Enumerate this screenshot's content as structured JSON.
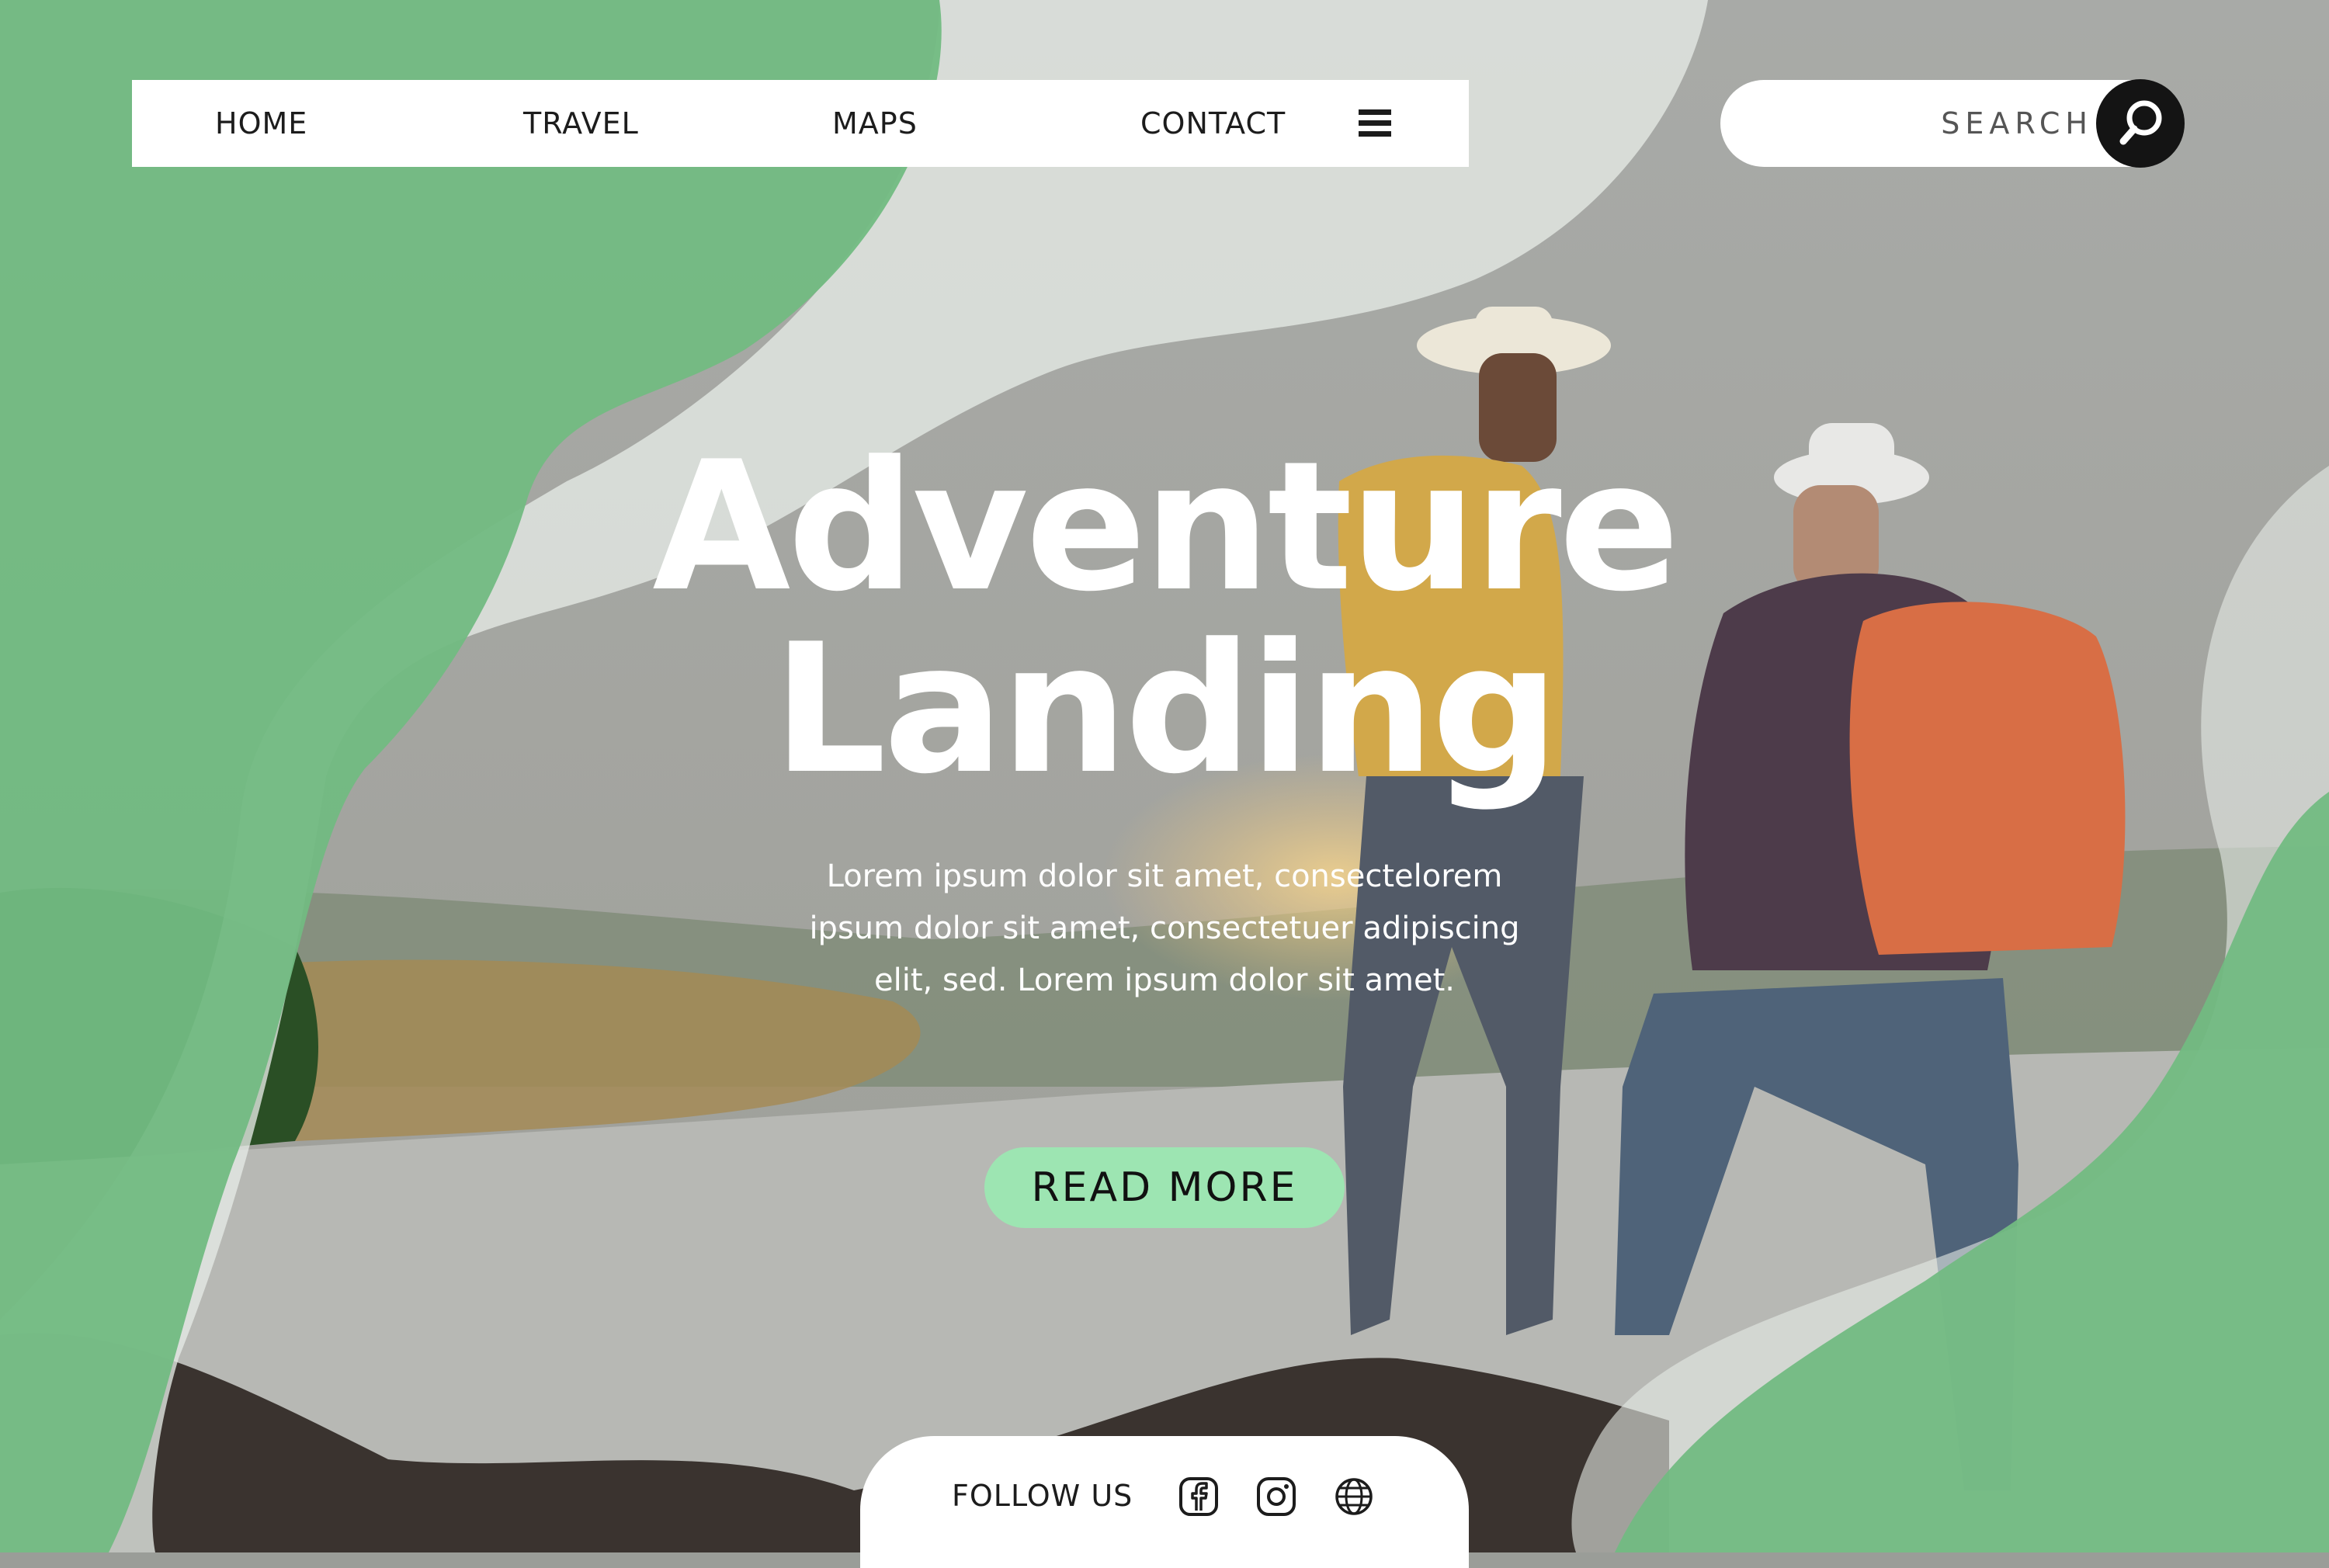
{
  "nav": {
    "items": [
      {
        "label": "HOME"
      },
      {
        "label": "TRAVEL"
      },
      {
        "label": "MAPS"
      },
      {
        "label": "CONTACT"
      }
    ],
    "menu_icon": "hamburger-menu-icon"
  },
  "search": {
    "placeholder": "SEARCH",
    "icon": "magnifier-icon"
  },
  "hero": {
    "title_line1": "Adventure",
    "title_line2": "Landing",
    "body": "Lorem ipsum dolor sit amet, consectelorem ipsum dolor sit amet, consectetuer adipiscing elit, sed. Lorem ipsum dolor sit amet.",
    "button_label": "READ MORE"
  },
  "footer": {
    "follow_label": "FOLLOW US",
    "socials": [
      {
        "icon": "facebook-icon"
      },
      {
        "icon": "instagram-icon"
      },
      {
        "icon": "globe-icon"
      }
    ]
  },
  "colors": {
    "green": "#72bb82",
    "button_green": "#9de5b2",
    "white_blob": "#dfe4df",
    "dark": "#141414"
  }
}
